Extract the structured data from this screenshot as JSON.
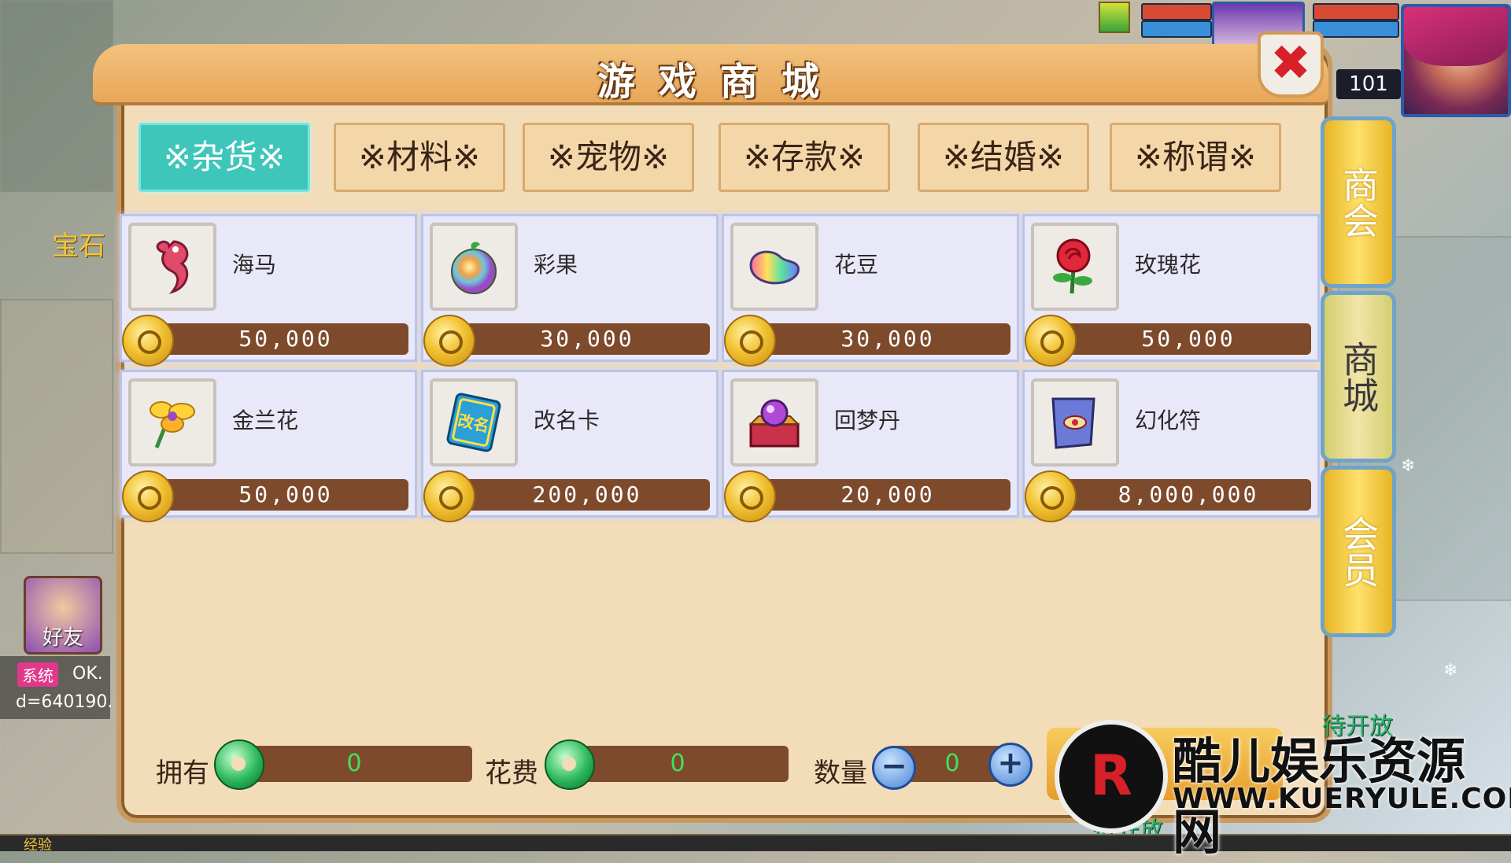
{
  "title": "游戏商城",
  "level": "101",
  "tabs": [
    {
      "label": "※杂货※",
      "active": true
    },
    {
      "label": "※材料※",
      "active": false
    },
    {
      "label": "※宠物※",
      "active": false
    },
    {
      "label": "※存款※",
      "active": false
    },
    {
      "label": "※结婚※",
      "active": false
    },
    {
      "label": "※称谓※",
      "active": false
    }
  ],
  "items": [
    {
      "name": "海马",
      "price": "50,000",
      "icon": "seahorse-icon"
    },
    {
      "name": "彩果",
      "price": "30,000",
      "icon": "rainbow-fruit-icon"
    },
    {
      "name": "花豆",
      "price": "30,000",
      "icon": "flower-bean-icon"
    },
    {
      "name": "玫瑰花",
      "price": "50,000",
      "icon": "rose-icon"
    },
    {
      "name": "金兰花",
      "price": "50,000",
      "icon": "golden-orchid-icon"
    },
    {
      "name": "改名卡",
      "price": "200,000",
      "icon": "rename-card-icon"
    },
    {
      "name": "回梦丹",
      "price": "20,000",
      "icon": "dream-pill-icon"
    },
    {
      "name": "幻化符",
      "price": "8,000,000",
      "icon": "transform-scroll-icon"
    }
  ],
  "rename_card_text": "改名",
  "side_tabs": [
    {
      "label": "商会",
      "active": false
    },
    {
      "label": "商城",
      "active": true
    },
    {
      "label": "会员",
      "active": false
    }
  ],
  "bottom": {
    "own_label": "拥有",
    "own_value": "0",
    "cost_label": "花费",
    "cost_value": "0",
    "qty_label": "数量",
    "qty_value": "0",
    "minus": "−",
    "plus": "+"
  },
  "left": {
    "gem_label": "宝石",
    "friend_label": "好友",
    "chat_sys": "系统",
    "chat_line1": "OK.",
    "chat_line2": "d=640190."
  },
  "waiting_text": "待开放",
  "exp_label": "经验",
  "close_symbol": "✖",
  "watermark": {
    "logo": "R",
    "cn": "酷儿娱乐资源网",
    "en": "WWW.KUERYULE.COM"
  },
  "colors": {
    "active_tab": "#3fc6bb",
    "price_bar": "#7d4b2c",
    "panel": "#f3dcb8",
    "value_text": "#43e15a"
  }
}
